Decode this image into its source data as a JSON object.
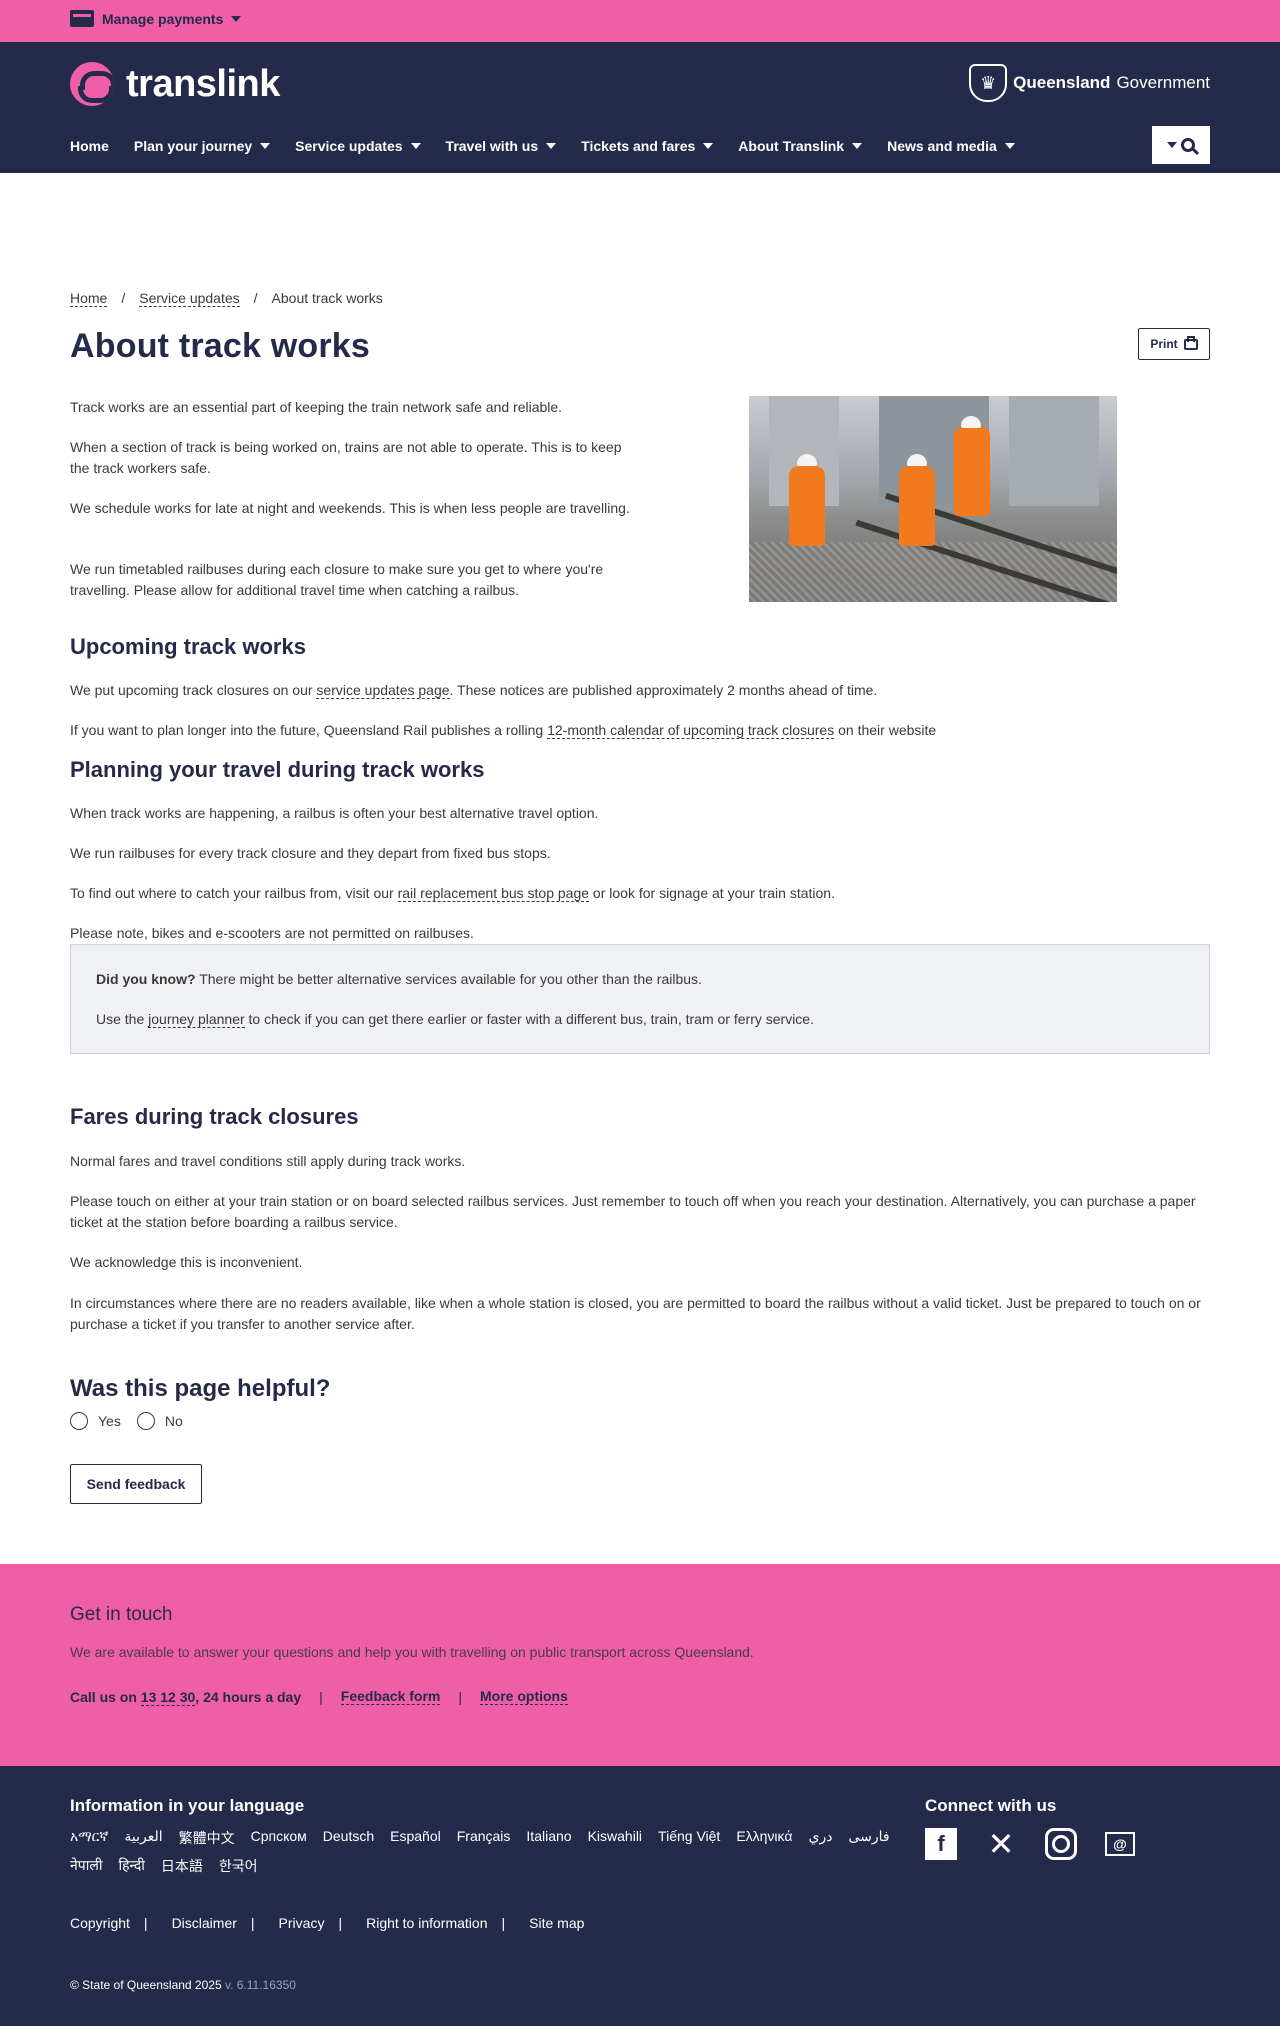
{
  "top_bar": {
    "manage_payments": "Manage payments"
  },
  "header": {
    "logo_text": "translink",
    "gov_bold": "Queensland",
    "gov_rest": "Government",
    "nav": [
      {
        "label": "Home"
      },
      {
        "label": "Plan your journey"
      },
      {
        "label": "Service updates"
      },
      {
        "label": "Travel with us"
      },
      {
        "label": "Tickets and fares"
      },
      {
        "label": "About Translink"
      },
      {
        "label": "News and media"
      }
    ]
  },
  "breadcrumb": {
    "home": "Home",
    "service_updates": "Service updates",
    "current": "About track works",
    "separator": "/"
  },
  "page": {
    "title": "About track works",
    "print_label": "Print",
    "intro": [
      "Track works are an essential part of keeping the train network safe and reliable.",
      "When a section of track is being worked on, trains are not able to operate. This is to keep the track workers safe.",
      "We schedule works for late at night and weekends. This is when less people are travelling.",
      "We run timetabled railbuses during each closure to make sure you get to where you're travelling. Please allow for additional travel time when catching a railbus."
    ],
    "upcoming": {
      "heading": "Upcoming track works",
      "p1_before": "We put upcoming track closures on our ",
      "p1_link": "service updates page",
      "p1_after": ". These notices are published approximately 2 months ahead of time.",
      "p2_before": "If you want to plan longer into the future, Queensland Rail publishes a rolling ",
      "p2_link": "12-month calendar of upcoming track closures",
      "p2_after": " on their website"
    },
    "planning": {
      "heading": "Planning your travel during track works",
      "p1": "When track works are happening, a railbus is often your best alternative travel option.",
      "p2": "We run railbuses for every track closure and they depart from fixed bus stops.",
      "p3_before": "To find out where to catch your railbus from, visit our ",
      "p3_link": "rail replacement bus stop page",
      "p3_after": " or look for signage at your train station.",
      "p4": "Please note, bikes and e-scooters are not permitted on railbuses."
    },
    "callout": {
      "bold": "Did you know?",
      "line1": " There might be better alternative services available for you other than the railbus.",
      "line2_before": "Use the ",
      "line2_link": "journey planner",
      "line2_after": " to check if you can get there earlier or faster with a different bus, train, tram or ferry service."
    },
    "fares": {
      "heading": "Fares during track closures",
      "p1": "Normal fares and travel conditions still apply during track works.",
      "p2": "Please touch on either at your train station or on board selected railbus services. Just remember to touch off when you reach your destination. Alternatively, you can purchase a paper ticket at the station before boarding a railbus service.",
      "p3": "We acknowledge this is inconvenient.",
      "p4": "In circumstances where there are no readers available, like when a whole station is closed, you are permitted to board the railbus without a valid ticket. Just be prepared to touch on or purchase a ticket if you transfer to another service after."
    },
    "feedback": {
      "heading": "Was this page helpful?",
      "yes": "Yes",
      "no": "No",
      "send": "Send feedback"
    }
  },
  "get_in_touch": {
    "heading": "Get in touch",
    "description": "We are available to answer your questions and help you with travelling on public transport across Queensland.",
    "call_before": "Call us on ",
    "phone": "13 12 30",
    "call_after": ", 24 hours a day",
    "feedback_form": "Feedback form",
    "more_options": "More options",
    "separator": "|"
  },
  "footer": {
    "language_heading": "Information in your language",
    "languages": [
      "አማርኛ",
      "العربية",
      "繁體中文",
      "Српском",
      "Deutsch",
      "Español",
      "Français",
      "Italiano",
      "Kiswahili",
      "Tiếng Việt",
      "Ελληνικά",
      "دري",
      "فارسی",
      "नेपाली",
      "हिन्दी",
      "日本語",
      "한국어"
    ],
    "connect_heading": "Connect with us",
    "social": [
      "facebook-icon",
      "x-icon",
      "instagram-icon",
      "email-icon"
    ],
    "legal": [
      "Copyright",
      "Disclaimer",
      "Privacy",
      "Right to information",
      "Site map"
    ],
    "legal_separator": "|",
    "copyright": "© State of Queensland 2025",
    "version": "v. 6.11.16350"
  },
  "colors": {
    "brand_pink": "#ef5fa7",
    "navy": "#252a4a",
    "callout_bg": "#f0f1f4"
  }
}
